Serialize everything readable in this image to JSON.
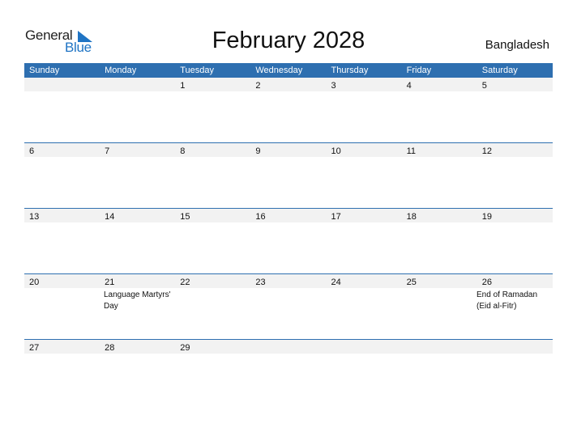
{
  "logo": {
    "text_general": "General",
    "text_blue": "Blue"
  },
  "title": "February 2028",
  "country": "Bangladesh",
  "colors": {
    "header_bg": "#2e6fb0",
    "date_row_bg": "#f2f2f2",
    "logo_blue": "#1f74c4"
  },
  "weekdays": [
    "Sunday",
    "Monday",
    "Tuesday",
    "Wednesday",
    "Thursday",
    "Friday",
    "Saturday"
  ],
  "weeks": [
    {
      "days": [
        "",
        "",
        "1",
        "2",
        "3",
        "4",
        "5"
      ],
      "events": [
        "",
        "",
        "",
        "",
        "",
        "",
        ""
      ]
    },
    {
      "days": [
        "6",
        "7",
        "8",
        "9",
        "10",
        "11",
        "12"
      ],
      "events": [
        "",
        "",
        "",
        "",
        "",
        "",
        ""
      ]
    },
    {
      "days": [
        "13",
        "14",
        "15",
        "16",
        "17",
        "18",
        "19"
      ],
      "events": [
        "",
        "",
        "",
        "",
        "",
        "",
        ""
      ]
    },
    {
      "days": [
        "20",
        "21",
        "22",
        "23",
        "24",
        "25",
        "26"
      ],
      "events": [
        "",
        "Language Martyrs' Day",
        "",
        "",
        "",
        "",
        "End of Ramadan (Eid al-Fitr)"
      ]
    },
    {
      "days": [
        "27",
        "28",
        "29",
        "",
        "",
        "",
        ""
      ],
      "events": [
        "",
        "",
        "",
        "",
        "",
        "",
        ""
      ]
    }
  ]
}
